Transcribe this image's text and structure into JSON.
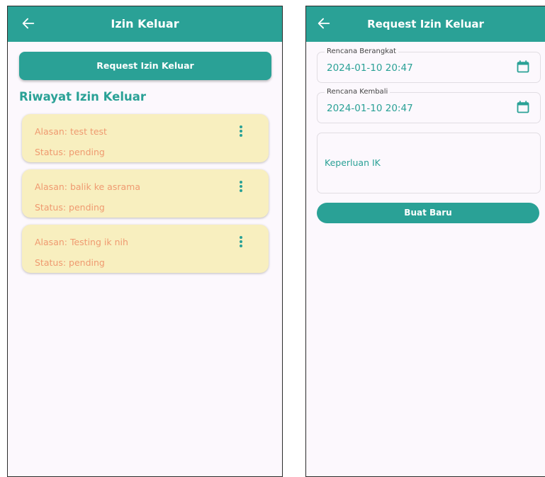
{
  "screen1": {
    "title": "Izin Keluar",
    "request_button": "Request Izin Keluar",
    "section_title": "Riwayat Izin Keluar",
    "items": [
      {
        "alasan": "Alasan: test test",
        "status": "Status: pending"
      },
      {
        "alasan": "Alasan: balik ke asrama",
        "status": "Status: pending"
      },
      {
        "alasan": "Alasan: Testing ik nih",
        "status": "Status: pending"
      }
    ]
  },
  "screen2": {
    "title": "Request Izin Keluar",
    "berangkat": {
      "label": "Rencana Berangkat",
      "value": "2024-01-10 20:47"
    },
    "kembali": {
      "label": "Rencana Kembali",
      "value": "2024-01-10 20:47"
    },
    "keperluan_placeholder": "Keperluan IK",
    "submit_button": "Buat Baru"
  },
  "colors": {
    "primary": "#2aa196",
    "card": "#f8efbf",
    "card_text": "#ef9a70",
    "background": "#fcf8fd"
  },
  "icons": {
    "back": "arrow-left-icon",
    "menu": "more-vert-icon",
    "calendar": "calendar-icon"
  }
}
